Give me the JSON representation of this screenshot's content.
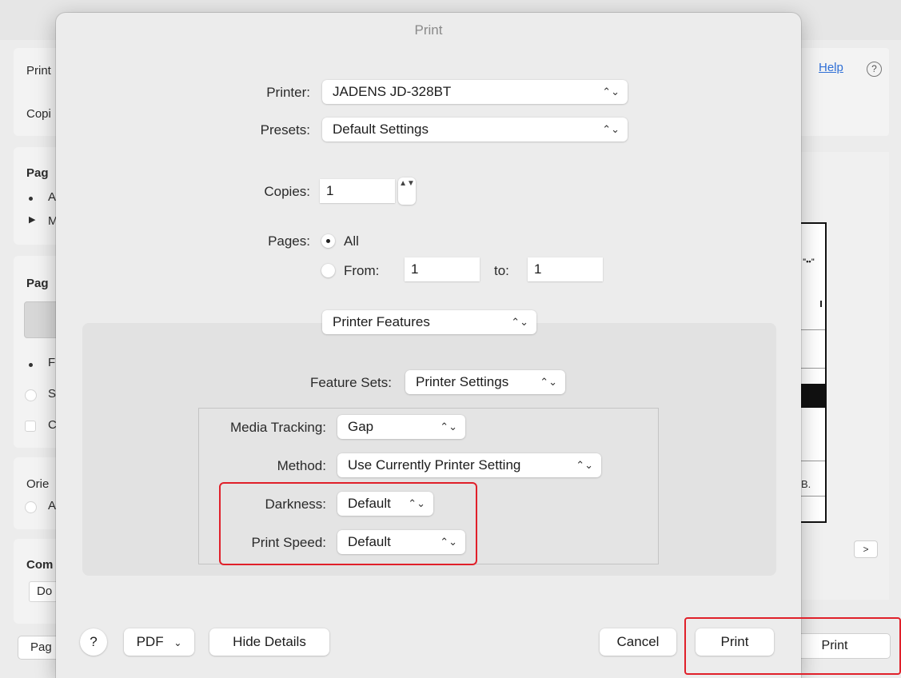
{
  "background_window": {
    "left_labels": [
      "Print",
      "Copi",
      "Pag",
      "A",
      "M",
      "Pag",
      "Fi",
      "S",
      "C",
      "Orie",
      "A",
      "Com",
      "Do",
      "Pag"
    ],
    "help_link": "Help",
    "help_icon_glyph": "?",
    "print_button": "Print",
    "next_button": ">",
    "preview_text_top": "\"••\"",
    "preview_text_bottom": "B."
  },
  "dialog": {
    "title": "Print",
    "printer_label": "Printer:",
    "printer_value": "JADENS JD-328BT",
    "presets_label": "Presets:",
    "presets_value": "Default Settings",
    "copies_label": "Copies:",
    "copies_value": "1",
    "pages_label": "Pages:",
    "pages_all_label": "All",
    "pages_from_label": "From:",
    "pages_from_value": "1",
    "pages_to_label": "to:",
    "pages_to_value": "1",
    "section_popup": "Printer Features",
    "feature_sets_label": "Feature Sets:",
    "feature_sets_value": "Printer Settings",
    "media_tracking_label": "Media Tracking:",
    "media_tracking_value": "Gap",
    "method_label": "Method:",
    "method_value": "Use Currently Printer Setting",
    "darkness_label": "Darkness:",
    "darkness_value": "Default",
    "print_speed_label": "Print Speed:",
    "print_speed_value": "Default",
    "help_button": "?",
    "pdf_button": "PDF",
    "hide_details_button": "Hide Details",
    "cancel_button": "Cancel",
    "print_button": "Print"
  },
  "icons": {
    "popup_chevron": "⌃⌄",
    "pdf_chevron": "⌄",
    "stepper": "▲▼"
  },
  "colors": {
    "highlight_red": "#e0202a",
    "link_blue": "#2f6fd6",
    "dialog_bg": "#ececec"
  }
}
